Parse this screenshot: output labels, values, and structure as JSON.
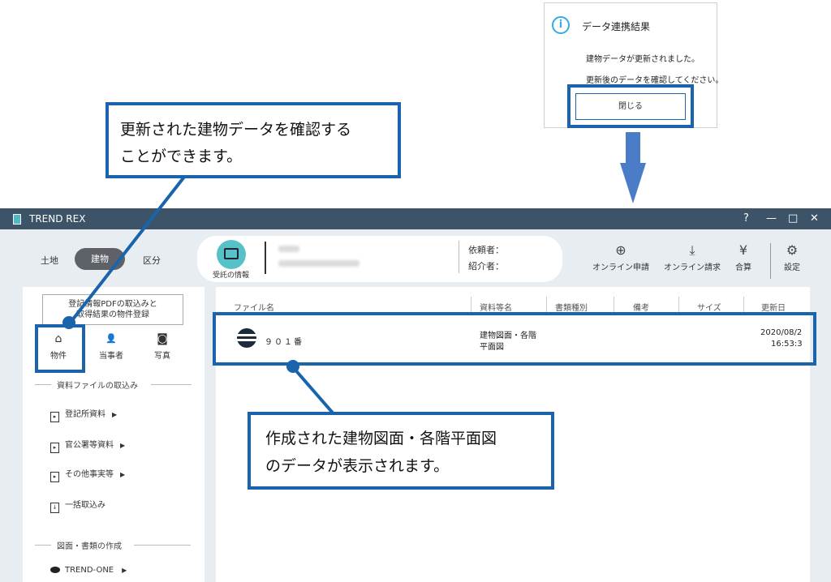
{
  "dialog": {
    "title": "データ連携結果",
    "message1": "建物データが更新されました。",
    "message2": "更新後のデータを確認してください。",
    "close_label": "閉じる"
  },
  "callouts": {
    "top_line1": "更新された建物データを確認する",
    "top_line2": "ことができます。",
    "bottom_line1": "作成された建物図面・各階平面図",
    "bottom_line2": "のデータが表示されます。"
  },
  "window": {
    "title": "TREND REX",
    "help": "?",
    "minimize": "—",
    "maximize": "□",
    "close": "✕"
  },
  "segments": {
    "land": "土地",
    "building": "建物",
    "unit": "区分"
  },
  "info_panel": {
    "label": "受託の情報",
    "requester_label": "依頼者：",
    "introducer_label": "紹介者："
  },
  "toolbar": {
    "online_apply": "オンライン申請",
    "online_bill": "オンライン請求",
    "total": "合算",
    "settings": "設定"
  },
  "sidebar": {
    "register_line1": "登記情報PDFの取込みと",
    "register_line2": "取得結果の物件登録",
    "tabs": [
      {
        "label": "物件",
        "icon": "⌂"
      },
      {
        "label": "当事者",
        "icon": "👤"
      },
      {
        "label": "写真",
        "icon": "◙"
      }
    ],
    "section1": "資料ファイルの取込み",
    "items": [
      "登記所資料",
      "官公署等資料",
      "その他事実等",
      "一括取込み"
    ],
    "section2": "図面・書類の作成",
    "trend_one": "TREND-ONE"
  },
  "table": {
    "columns": [
      "ファイル名",
      "資料等名",
      "書類種別",
      "備考",
      "サイズ",
      "更新日"
    ],
    "row": {
      "file_name": "９０１番",
      "doc_name1": "建物図面・各階",
      "doc_name2": "平面図",
      "date": "2020/08/2",
      "time": "16:53:3"
    }
  }
}
